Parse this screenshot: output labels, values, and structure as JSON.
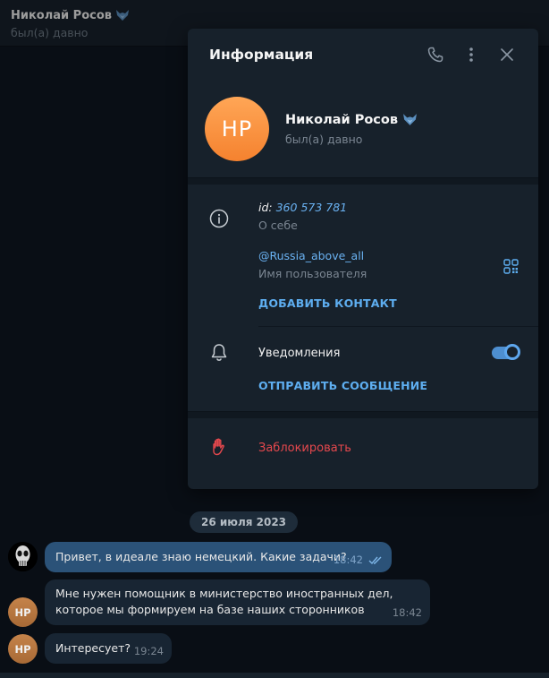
{
  "header": {
    "name": "Николай Росов",
    "status": "был(а) давно"
  },
  "panel": {
    "title": "Информация",
    "avatar_initials": "НР",
    "name": "Николай Росов",
    "status": "был(а) давно",
    "id_label": "id:",
    "id_value": "360 573 781",
    "about_label": "О себе",
    "username": "@Russia_above_all",
    "username_label": "Имя пользователя",
    "add_contact": "ДОБАВИТЬ КОНТАКТ",
    "notifications_label": "Уведомления",
    "notifications_on": true,
    "send_message": "ОТПРАВИТЬ СООБЩЕНИЕ",
    "block": "Заблокировать"
  },
  "chat": {
    "date": "26 июля 2023",
    "messages": [
      {
        "direction": "out",
        "text": "Привет, в идеале знаю немецкий. Какие задачи?",
        "time": "18:42",
        "read": true
      },
      {
        "direction": "in",
        "avatar": "НР",
        "text_line1": "Мне нужен помощник в министерство иностранных дел,",
        "text_line2": "которое мы формируем на базе наших сторонников",
        "time": "18:42"
      },
      {
        "direction": "in",
        "avatar": "НР",
        "text": "Интересует?",
        "time": "19:24"
      }
    ]
  },
  "colors": {
    "accent": "#5eaef0",
    "danger": "#e5484d",
    "avatar_orange": "#f5822f",
    "panel_bg": "#17212b",
    "chat_bg": "#0e1621"
  },
  "icons": {
    "verified": "fox-emoji-icon",
    "call": "phone-icon",
    "more": "more-vertical-icon",
    "close": "close-icon",
    "info": "info-icon",
    "qr": "qr-code-icon",
    "notifications": "bell-icon",
    "block": "hand-icon"
  }
}
